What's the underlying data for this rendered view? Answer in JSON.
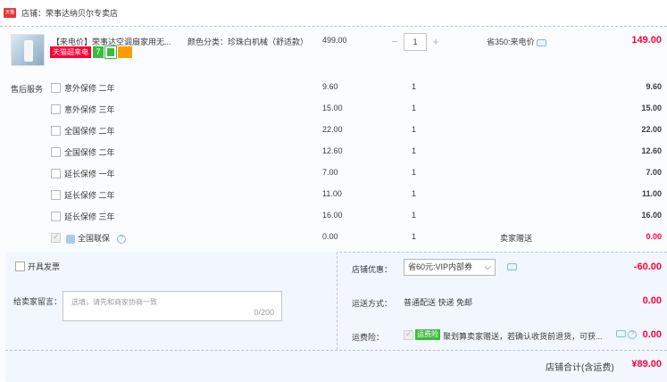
{
  "shop": {
    "icon": "tmall-shop-icon",
    "label": "店铺：",
    "name": "荣事达纳贝尔专卖店"
  },
  "item": {
    "title": "【来电价】荣事达空调扇家用无...",
    "badges": {
      "tmall": "天猫超来电",
      "seven": "7"
    },
    "spec": "颜色分类：珍珠白机械（舒适款）",
    "unit_price": "499.00",
    "quantity": "1",
    "saving": "省350:来电价",
    "total": "149.00",
    "minus": "−",
    "plus": "+"
  },
  "services": {
    "heading": "售后服务",
    "rows": [
      {
        "name": "意外保修 二年",
        "price": "9.60",
        "qty": "1",
        "total": "9.60"
      },
      {
        "name": "意外保修 三年",
        "price": "15.00",
        "qty": "1",
        "total": "15.00"
      },
      {
        "name": "全国保修 二年",
        "price": "22.00",
        "qty": "1",
        "total": "22.00"
      },
      {
        "name": "全国保修 二年",
        "price": "12.60",
        "qty": "1",
        "total": "12.60"
      },
      {
        "name": "延长保修 一年",
        "price": "7.00",
        "qty": "1",
        "total": "7.00"
      },
      {
        "name": "延长保修 二年",
        "price": "11.00",
        "qty": "1",
        "total": "11.00"
      },
      {
        "name": "延长保修 三年",
        "price": "16.00",
        "qty": "1",
        "total": "16.00"
      }
    ],
    "warranty": {
      "name": "全国联保",
      "price": "0.00",
      "qty": "1",
      "note": "卖家赠送",
      "total": "0.00"
    }
  },
  "invoice": {
    "label": "开具发票"
  },
  "message": {
    "label": "给卖家留言：",
    "placeholder": "选填，请先和商家协商一致",
    "count": "0/200"
  },
  "promo": {
    "label": "店铺优惠：",
    "selected": "省60元:VIP内部券",
    "amount": "-60.00"
  },
  "shipping": {
    "label": "运送方式：",
    "value": "普通配送 快递 免邮",
    "amount": "0.00"
  },
  "insurance": {
    "label": "运费险：",
    "tag": "运费险",
    "text": "聚划算卖家赠送，若确认收货前退货，可获...",
    "amount": "0.00"
  },
  "grand_total": {
    "label": "店铺合计(含运费)",
    "amount": "¥89.00"
  }
}
